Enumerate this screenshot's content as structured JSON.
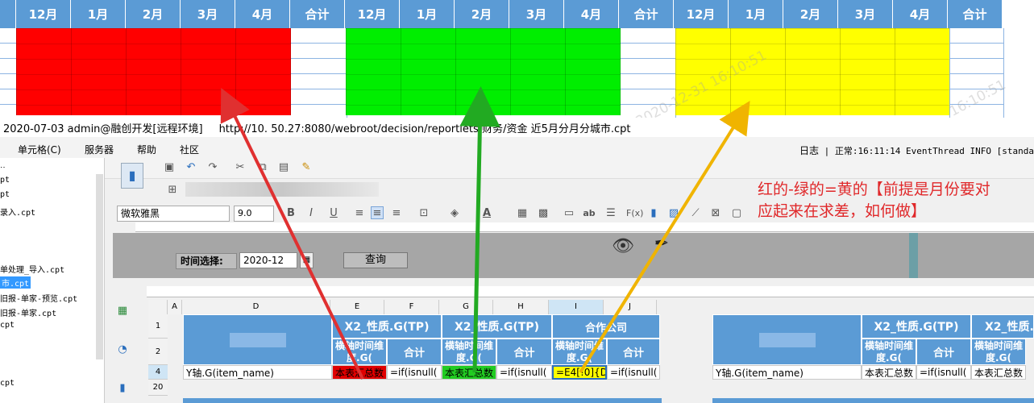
{
  "preview": {
    "headers": [
      "",
      "12月",
      "1月",
      "2月",
      "3月",
      "4月",
      "合计",
      "12月",
      "1月",
      "2月",
      "3月",
      "4月",
      "合计",
      "12月",
      "1月",
      "2月",
      "3月",
      "4月",
      "合计"
    ],
    "block_colors": {
      "red": "#ff0000",
      "green": "#00ee00",
      "yellow": "#ffff00"
    },
    "header_color": "#5b9bd5",
    "watermark_1": "2020-12-31 16:10:51",
    "watermark_2": "16:10:51"
  },
  "window": {
    "title": "2020-07-03 admin@融创开发[远程环境]",
    "path": "http://10.  50.27:8080/webroot/decision/reportlets/财务/资金   近5月分月分城市.cpt"
  },
  "menu": {
    "cell": "单元格(C)",
    "server": "服务器",
    "help": "帮助",
    "community": "社区",
    "log_label": "日志",
    "log_text": "| 正常:16:11:14 EventThread INFO [standa"
  },
  "files": [
    "pt",
    "pt",
    "录入.cpt",
    "单处理_导入.cpt",
    "市.cpt",
    "旧报-单家-预览.cpt",
    "旧报-单家.cpt",
    "cpt",
    "cpt"
  ],
  "font": {
    "name": "微软雅黑",
    "size": "9.0"
  },
  "annotation": {
    "line1": "红的-绿的=黄的【前提是月份要对",
    "line2": "应起来在求差，如何做】"
  },
  "param": {
    "label": "时间选择:",
    "value": "2020-12",
    "query": "查询"
  },
  "sheet": {
    "col_heads": [
      "",
      "A",
      "D",
      "E",
      "F",
      "G",
      "H",
      "I",
      "J"
    ],
    "row_heads": [
      "1",
      "2",
      "4",
      "20"
    ],
    "group1": "X2_性质.G(TP)",
    "group2": "X2_性质.G(TP)",
    "group3": "合作公司",
    "group4": "X2_性质.G(TP)",
    "group5": "X2_性质.",
    "axis_time": "横轴时间维度.G(",
    "total": "合计",
    "y_axis": "Y轴.G(item_name)",
    "summary": "本表汇总数",
    "formula_if": "=if(isnull(",
    "formula_diff": "=E4[!0]{D4",
    "colors": {
      "red": "#e00000",
      "green": "#22cc22",
      "yellow": "#ffff00",
      "header": "#5b9bd5"
    }
  }
}
